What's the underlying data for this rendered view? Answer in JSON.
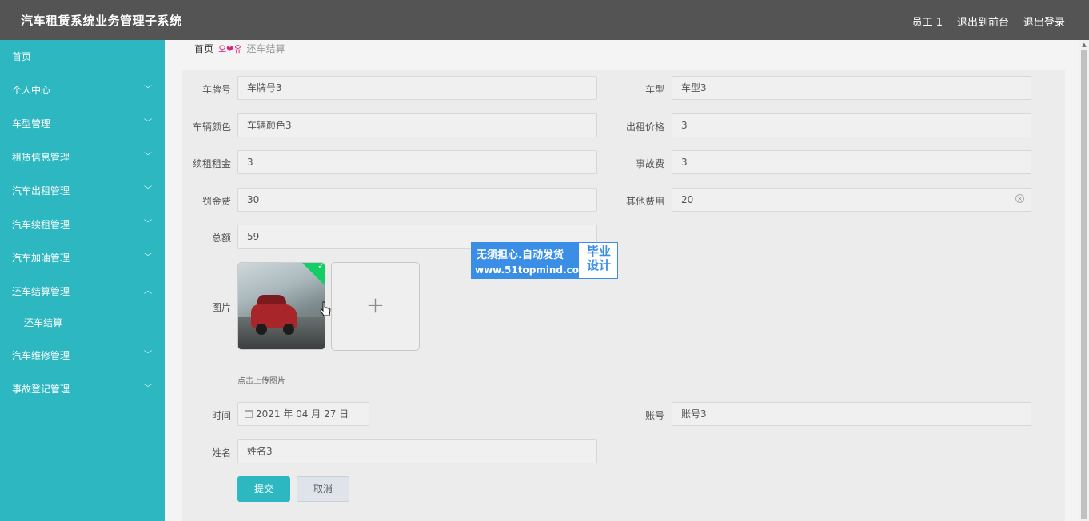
{
  "header": {
    "app_title": "汽车租赁系统业务管理子系统",
    "user": "员工 1",
    "front_link": "退出到前台",
    "logout": "退出登录"
  },
  "sidebar": {
    "items": [
      {
        "label": "首页"
      },
      {
        "label": "个人中心"
      },
      {
        "label": "车型管理"
      },
      {
        "label": "租赁信息管理"
      },
      {
        "label": "汽车出租管理"
      },
      {
        "label": "汽车续租管理"
      },
      {
        "label": "汽车加油管理"
      },
      {
        "label": "还车结算管理"
      },
      {
        "label": "汽车维修管理"
      },
      {
        "label": "事故登记管理"
      }
    ],
    "subitem": "还车结算"
  },
  "breadcrumb": {
    "home": "首页",
    "sep": "오❤유",
    "current": "还车结算"
  },
  "form": {
    "plate_label": "车牌号",
    "plate_value": "车牌号3",
    "model_label": "车型",
    "model_value": "车型3",
    "color_label": "车辆颜色",
    "color_value": "车辆颜色3",
    "price_label": "出租价格",
    "price_value": "3",
    "renew_label": "续租租金",
    "renew_value": "3",
    "accident_label": "事故费",
    "accident_value": "3",
    "fine_label": "罚金费",
    "fine_value": "30",
    "other_label": "其他费用",
    "other_value": "20",
    "total_label": "总额",
    "total_value": "59",
    "image_label": "图片",
    "upload_tip": "点击上传图片",
    "time_label": "时间",
    "time_value": "2021 年 04 月 27 日",
    "account_label": "账号",
    "account_value": "账号3",
    "name_label": "姓名",
    "name_value": "姓名3",
    "submit": "提交",
    "cancel": "取消"
  },
  "watermark": {
    "line1": "无须担心.自动发货",
    "line2": "www.51topmind.com",
    "right": "毕业设计"
  },
  "colors": {
    "sidebar": "#2db7c1",
    "header": "#545454",
    "accent": "#2db7c1"
  }
}
